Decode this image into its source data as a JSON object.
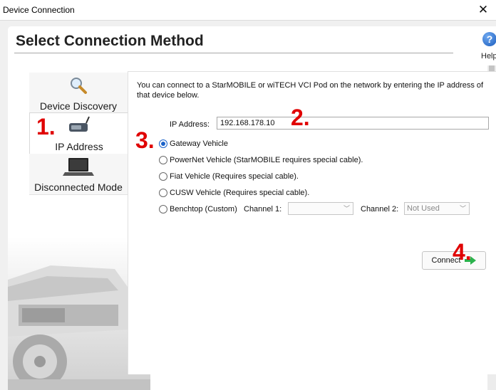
{
  "window": {
    "title": "Device Connection",
    "close_glyph": "✕"
  },
  "page": {
    "title": "Select Connection Method",
    "help_label": "Help"
  },
  "nav": {
    "items": [
      {
        "label": "Device Discovery",
        "icon": "magnifier-icon"
      },
      {
        "label": "IP Address",
        "icon": "vci-pod-icon",
        "active": true
      },
      {
        "label": "Disconnected Mode",
        "icon": "laptop-icon"
      }
    ]
  },
  "panel": {
    "intro": "You can connect to a StarMOBILE or wiTECH VCI Pod on the network by entering the IP address of that device below.",
    "ip_label": "IP Address:",
    "ip_value": "192.168.178.10",
    "options": [
      {
        "label": "Gateway Vehicle",
        "checked": true
      },
      {
        "label": "PowerNet Vehicle (StarMOBILE requires special cable).",
        "checked": false
      },
      {
        "label": "Fiat Vehicle (Requires special cable).",
        "checked": false
      },
      {
        "label": "CUSW Vehicle (Requires special cable).",
        "checked": false
      },
      {
        "label": "Benchtop (Custom)",
        "checked": false
      }
    ],
    "channel1_label": "Channel 1:",
    "channel1_value": "",
    "channel2_label": "Channel 2:",
    "channel2_value": "Not Used",
    "connect_label": "Connect"
  },
  "annotations": {
    "a1": "1.",
    "a2": "2.",
    "a3": "3.",
    "a4": "4."
  },
  "colors": {
    "annotation": "#e00000",
    "radio_checked": "#1a62c9",
    "connect_arrow": "#2bb24c"
  }
}
